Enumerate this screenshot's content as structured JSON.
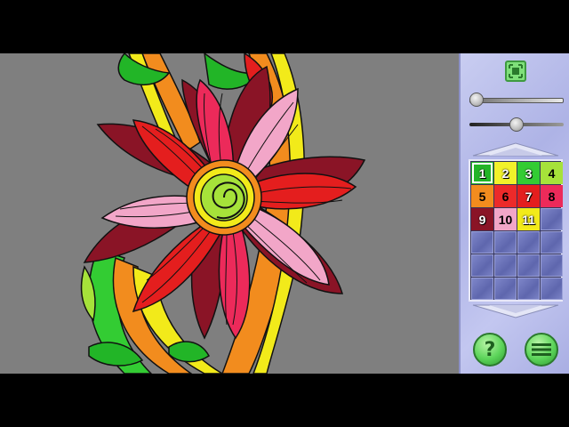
{
  "colors": {
    "canvas_bg": "#7f7f7f",
    "letterbox": "#000000",
    "panel_bg": "#b9bdec"
  },
  "controls": {
    "fit_icon": "fit-to-screen-icon",
    "zoom_slider_level": 0.0,
    "brightness_slider_level": 0.5,
    "help_label": "?",
    "menu_icon": "menu-icon"
  },
  "palette": {
    "selected": 1,
    "swatches": [
      {
        "number": "1",
        "color": "#22b527",
        "text_color": "#ffffff"
      },
      {
        "number": "2",
        "color": "#f2f22a",
        "text_color": "#ffffff"
      },
      {
        "number": "3",
        "color": "#33cc33",
        "text_color": "#ffffff"
      },
      {
        "number": "4",
        "color": "#a6e23a",
        "text_color": "#000000"
      },
      {
        "number": "5",
        "color": "#f28c1e",
        "text_color": "#000000"
      },
      {
        "number": "6",
        "color": "#ec2a2a",
        "text_color": "#000000"
      },
      {
        "number": "7",
        "color": "#e41e1e",
        "text_color": "#ffffff"
      },
      {
        "number": "8",
        "color": "#ec2a5a",
        "text_color": "#000000"
      },
      {
        "number": "9",
        "color": "#8a1426",
        "text_color": "#ffffff"
      },
      {
        "number": "10",
        "color": "#f2a6c8",
        "text_color": "#000000"
      },
      {
        "number": "11",
        "color": "#f2ea1a",
        "text_color": "#ffffff"
      }
    ],
    "empty_slots": 13
  }
}
